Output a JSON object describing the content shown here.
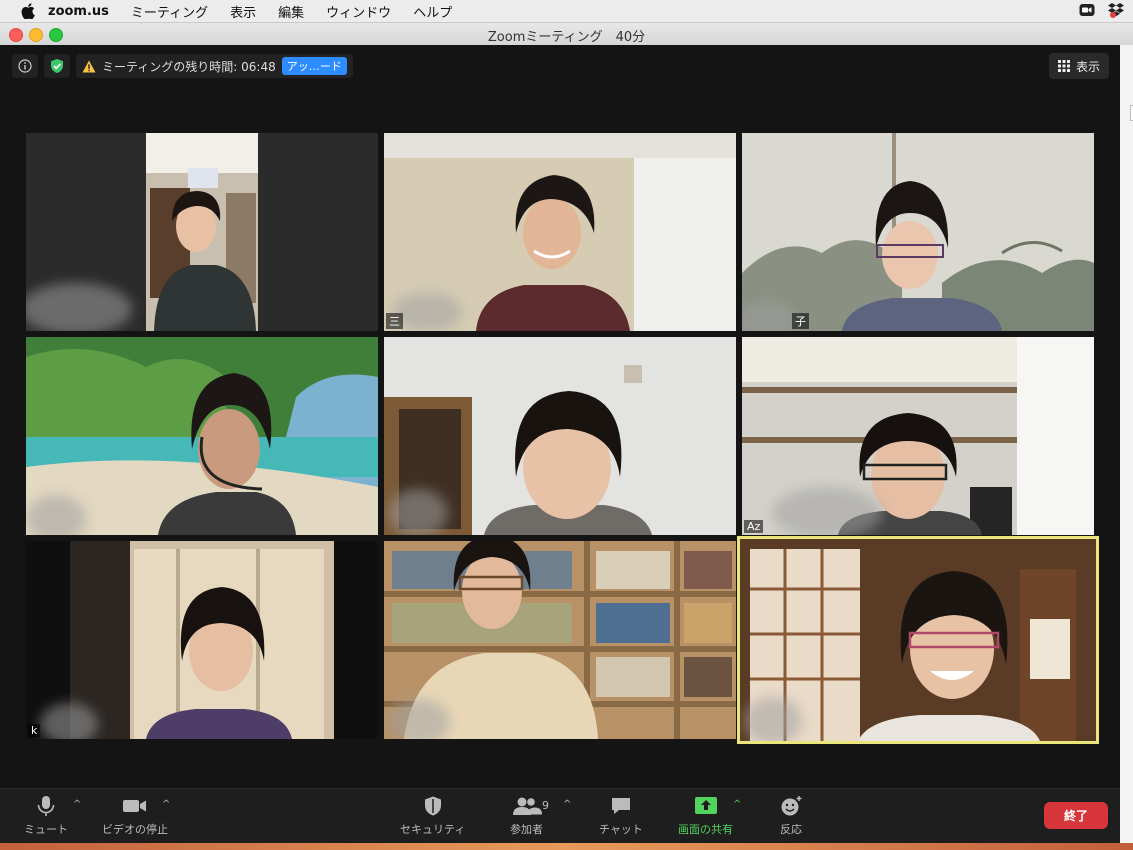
{
  "menubar": {
    "app": "zoom.us",
    "items": [
      "ミーティング",
      "表示",
      "編集",
      "ウィンドウ",
      "ヘルプ"
    ]
  },
  "window": {
    "title": "Zoomミーティング　40分"
  },
  "meeting": {
    "timer_text": "ミーティングの残り時間: 06:48",
    "upgrade_label": "アッ…ード",
    "view_label": "表示"
  },
  "participants": [
    {
      "name": ""
    },
    {
      "name": "三"
    },
    {
      "name": "子"
    },
    {
      "name": ""
    },
    {
      "name": ""
    },
    {
      "name": "Az"
    },
    {
      "name": "k"
    },
    {
      "name": ""
    },
    {
      "name": ""
    }
  ],
  "toolbar": {
    "mute_label": "ミュート",
    "video_label": "ビデオの停止",
    "security_label": "セキュリティ",
    "participants_label": "参加者",
    "participants_count": "9",
    "chat_label": "チャット",
    "share_label": "画面の共有",
    "reactions_label": "反応",
    "end_label": "終了"
  },
  "colors": {
    "share_green": "#52d35e",
    "end_red": "#d6363a",
    "active_speaker": "#eae67c",
    "upgrade_blue": "#2d8cff"
  }
}
